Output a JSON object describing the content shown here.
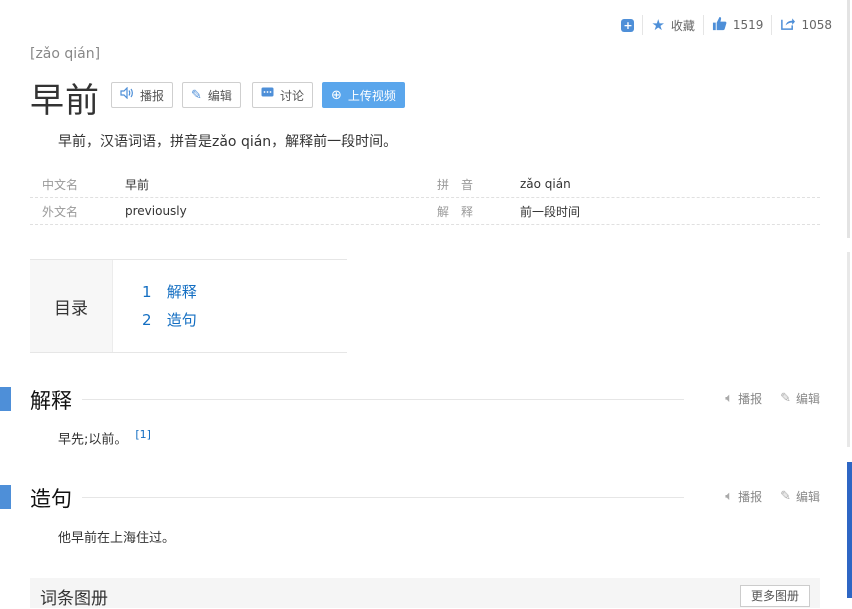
{
  "topbar": {
    "add_icon": "plus-square-icon",
    "collect_label": "收藏",
    "likes": "1519",
    "shares": "1058"
  },
  "entry": {
    "pinyin": "[zǎo qián]",
    "title": "早前",
    "summary": "早前，汉语词语，拼音是zǎo qián，解释前一段时间。"
  },
  "actions": {
    "broadcast": "播报",
    "edit": "编辑",
    "discuss": "讨论",
    "upload_video": "上传视频"
  },
  "basic_info": {
    "rows": [
      {
        "k1": "中文名",
        "v1": "早前",
        "k2": "拼　音",
        "v2": "zǎo qián"
      },
      {
        "k1": "外文名",
        "v1": "previously",
        "k2": "解　释",
        "v2": "前一段时间"
      }
    ]
  },
  "toc": {
    "label": "目录",
    "items": [
      {
        "num": "1",
        "label": "解释"
      },
      {
        "num": "2",
        "label": "造句"
      }
    ]
  },
  "sections": [
    {
      "title": "解释",
      "text": "早先;以前。",
      "ref": "[1]",
      "broadcast": "播报",
      "edit": "编辑"
    },
    {
      "title": "造句",
      "text": "他早前在上海住过。",
      "broadcast": "播报",
      "edit": "编辑"
    }
  ],
  "album": {
    "title": "词条图册",
    "more": "更多图册"
  },
  "colors": {
    "accent": "#4e8fd8",
    "link": "#136ec2",
    "primary_button": "#5aa6ec"
  }
}
